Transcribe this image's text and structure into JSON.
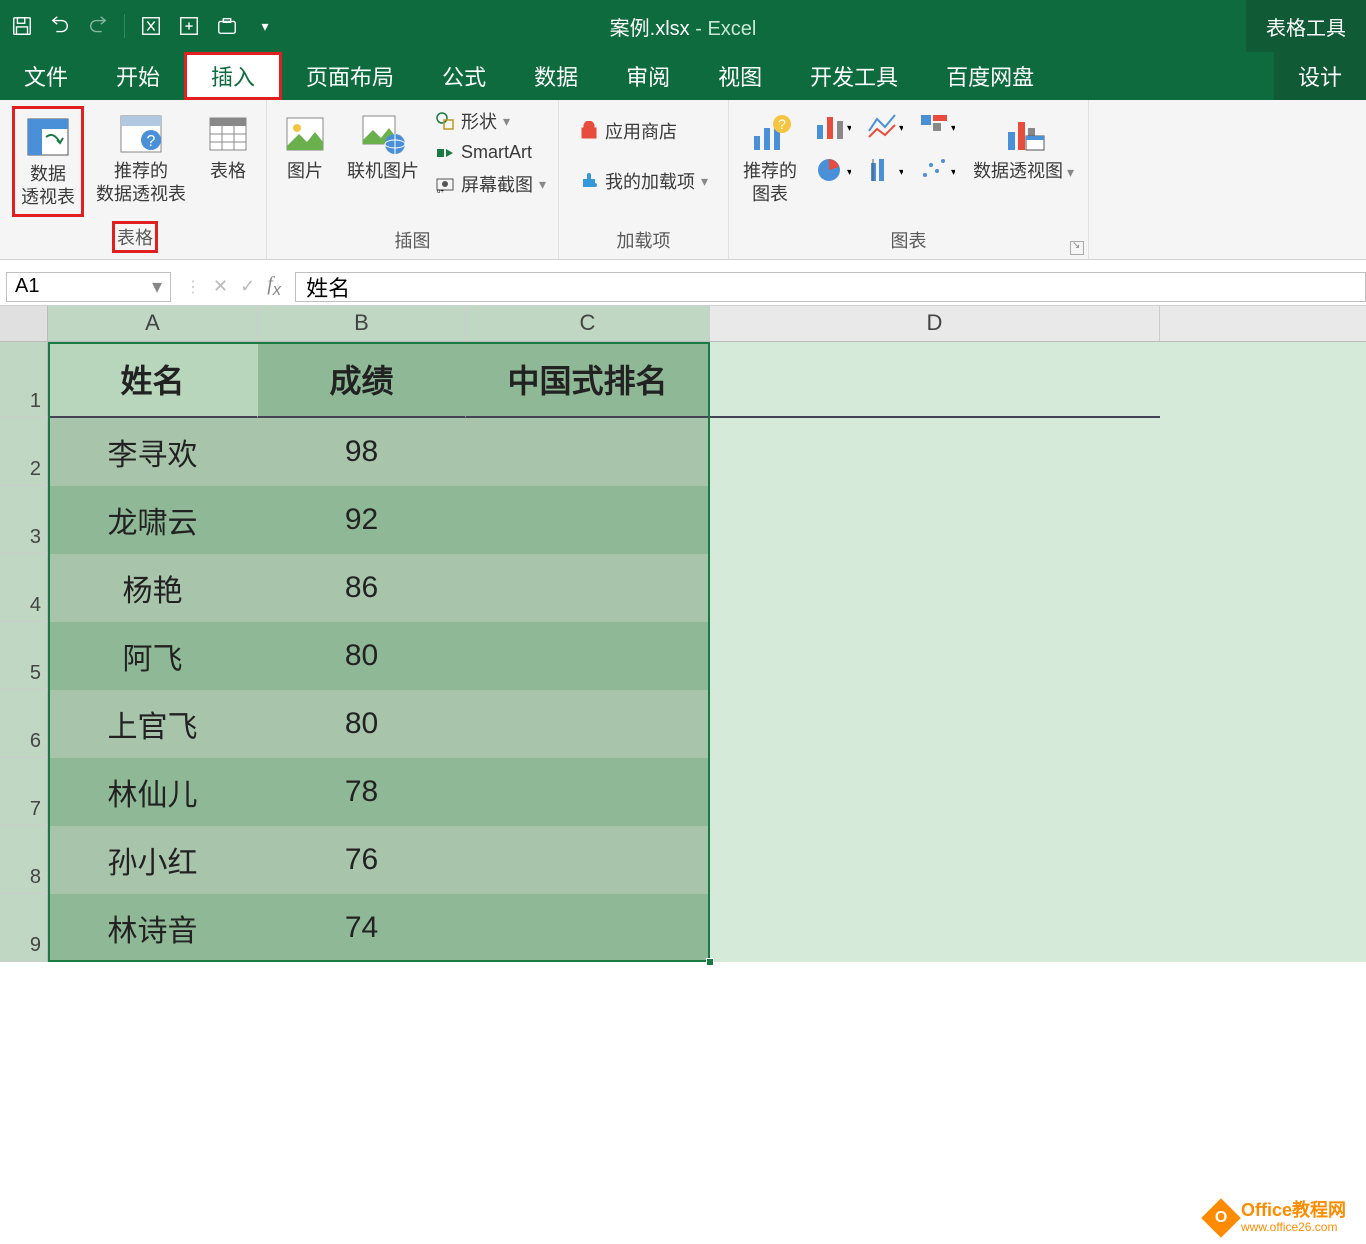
{
  "title": {
    "doc": "案例.xlsx",
    "app": "Excel",
    "context_tab": "表格工具"
  },
  "tabs": {
    "file": "文件",
    "home": "开始",
    "insert": "插入",
    "page_layout": "页面布局",
    "formulas": "公式",
    "data": "数据",
    "review": "审阅",
    "view": "视图",
    "developer": "开发工具",
    "baidu": "百度网盘",
    "design": "设计"
  },
  "ribbon": {
    "tables": {
      "pivot_table": "数据\n透视表",
      "recommended_pivot": "推荐的\n数据透视表",
      "table": "表格",
      "group_label": "表格"
    },
    "illustrations": {
      "picture": "图片",
      "online_picture": "联机图片",
      "shapes": "形状",
      "smartart": "SmartArt",
      "screenshot": "屏幕截图",
      "group_label": "插图"
    },
    "addins": {
      "store": "应用商店",
      "my_addins": "我的加载项",
      "group_label": "加载项"
    },
    "charts": {
      "recommended": "推荐的\n图表",
      "pivot_chart": "数据透视图",
      "group_label": "图表"
    }
  },
  "namebox": "A1",
  "formula_value": "姓名",
  "columns": [
    "A",
    "B",
    "C",
    "D"
  ],
  "table": {
    "headers": [
      "姓名",
      "成绩",
      "中国式排名"
    ],
    "rows": [
      {
        "name": "李寻欢",
        "score": "98",
        "rank": ""
      },
      {
        "name": "龙啸云",
        "score": "92",
        "rank": ""
      },
      {
        "name": "杨艳",
        "score": "86",
        "rank": ""
      },
      {
        "name": "阿飞",
        "score": "80",
        "rank": ""
      },
      {
        "name": "上官飞",
        "score": "80",
        "rank": ""
      },
      {
        "name": "林仙儿",
        "score": "78",
        "rank": ""
      },
      {
        "name": "孙小红",
        "score": "76",
        "rank": ""
      },
      {
        "name": "林诗音",
        "score": "74",
        "rank": ""
      }
    ]
  },
  "row_numbers": [
    "1",
    "2",
    "3",
    "4",
    "5",
    "6",
    "7",
    "8",
    "9"
  ],
  "watermark": {
    "main": "Office教程网",
    "sub": "www.office26.com"
  }
}
